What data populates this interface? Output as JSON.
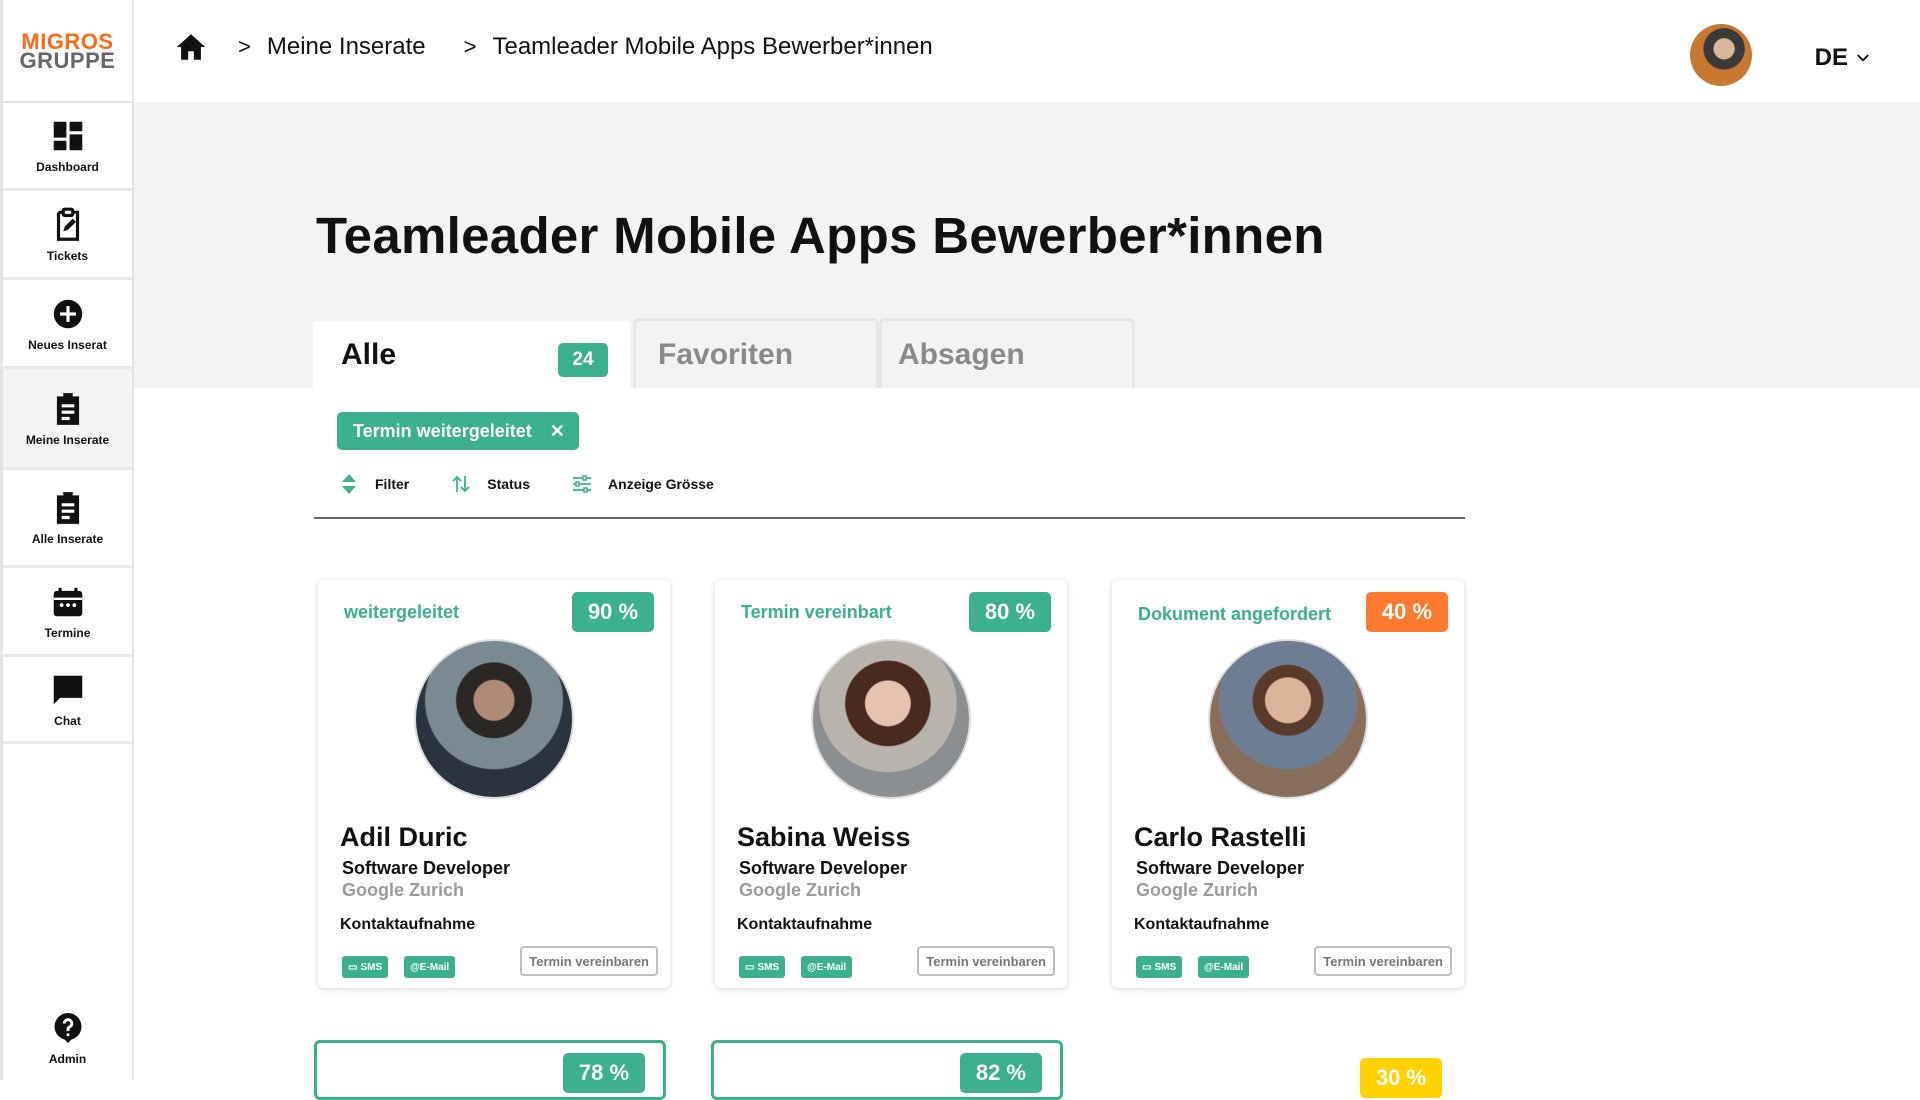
{
  "brand": {
    "line1": "MIGROS",
    "line2": "GRUPPE"
  },
  "sidebar": {
    "items": [
      {
        "label": "Dashboard",
        "icon": "dashboard-icon"
      },
      {
        "label": "Tickets",
        "icon": "clipboard-edit-icon"
      },
      {
        "label": "Neues Inserat",
        "icon": "plus-circle-icon"
      },
      {
        "label": "Meine Inserate",
        "icon": "clipboard-list-icon"
      },
      {
        "label": "Alle Inserate",
        "icon": "clipboard-list-icon"
      },
      {
        "label": "Termine",
        "icon": "calendar-icon"
      },
      {
        "label": "Chat",
        "icon": "chat-icon"
      }
    ],
    "admin_label": "Admin"
  },
  "breadcrumb": {
    "level1": "Meine Inserate",
    "level2": "Teamleader Mobile Apps Bewerber*innen"
  },
  "header": {
    "language": "DE"
  },
  "page": {
    "title": "Teamleader Mobile Apps Bewerber*innen"
  },
  "tabs": [
    {
      "label": "Alle",
      "count": "24"
    },
    {
      "label": "Favoriten"
    },
    {
      "label": "Absagen"
    }
  ],
  "filter_chip": {
    "label": "Termin weitergeleitet",
    "close": "✕"
  },
  "toolbar": {
    "filter": "Filter",
    "status": "Status",
    "size": "Anzeige Grösse"
  },
  "candidates": [
    {
      "status": "weitergeleitet",
      "score": "90 %",
      "name": "Adil Duric",
      "role": "Software Developer",
      "company": "Google Zurich",
      "contact": "Kontaktaufnahme",
      "sms": "SMS",
      "email": "@E-Mail",
      "cta": "Termin vereinbaren"
    },
    {
      "status": "Termin vereinbart",
      "score": "80 %",
      "name": "Sabina Weiss",
      "role": "Software Developer",
      "company": "Google Zurich",
      "contact": "Kontaktaufnahme",
      "sms": "SMS",
      "email": "@E-Mail",
      "cta": "Termin vereinbaren"
    },
    {
      "status": "Dokument angefordert",
      "score": "40 %",
      "name": "Carlo Rastelli",
      "role": "Software Developer",
      "company": "Google Zurich",
      "contact": "Kontaktaufnahme",
      "sms": "SMS",
      "email": "@E-Mail",
      "cta": "Termin vereinbaren"
    }
  ],
  "next_row": [
    {
      "score": "78 %"
    },
    {
      "score": "82 %"
    },
    {
      "score": "30 %"
    }
  ],
  "colors": {
    "accent": "#3bb08f",
    "orange": "#ff7a2f",
    "yellow": "#ffd200",
    "brand": "#ff6a13"
  }
}
